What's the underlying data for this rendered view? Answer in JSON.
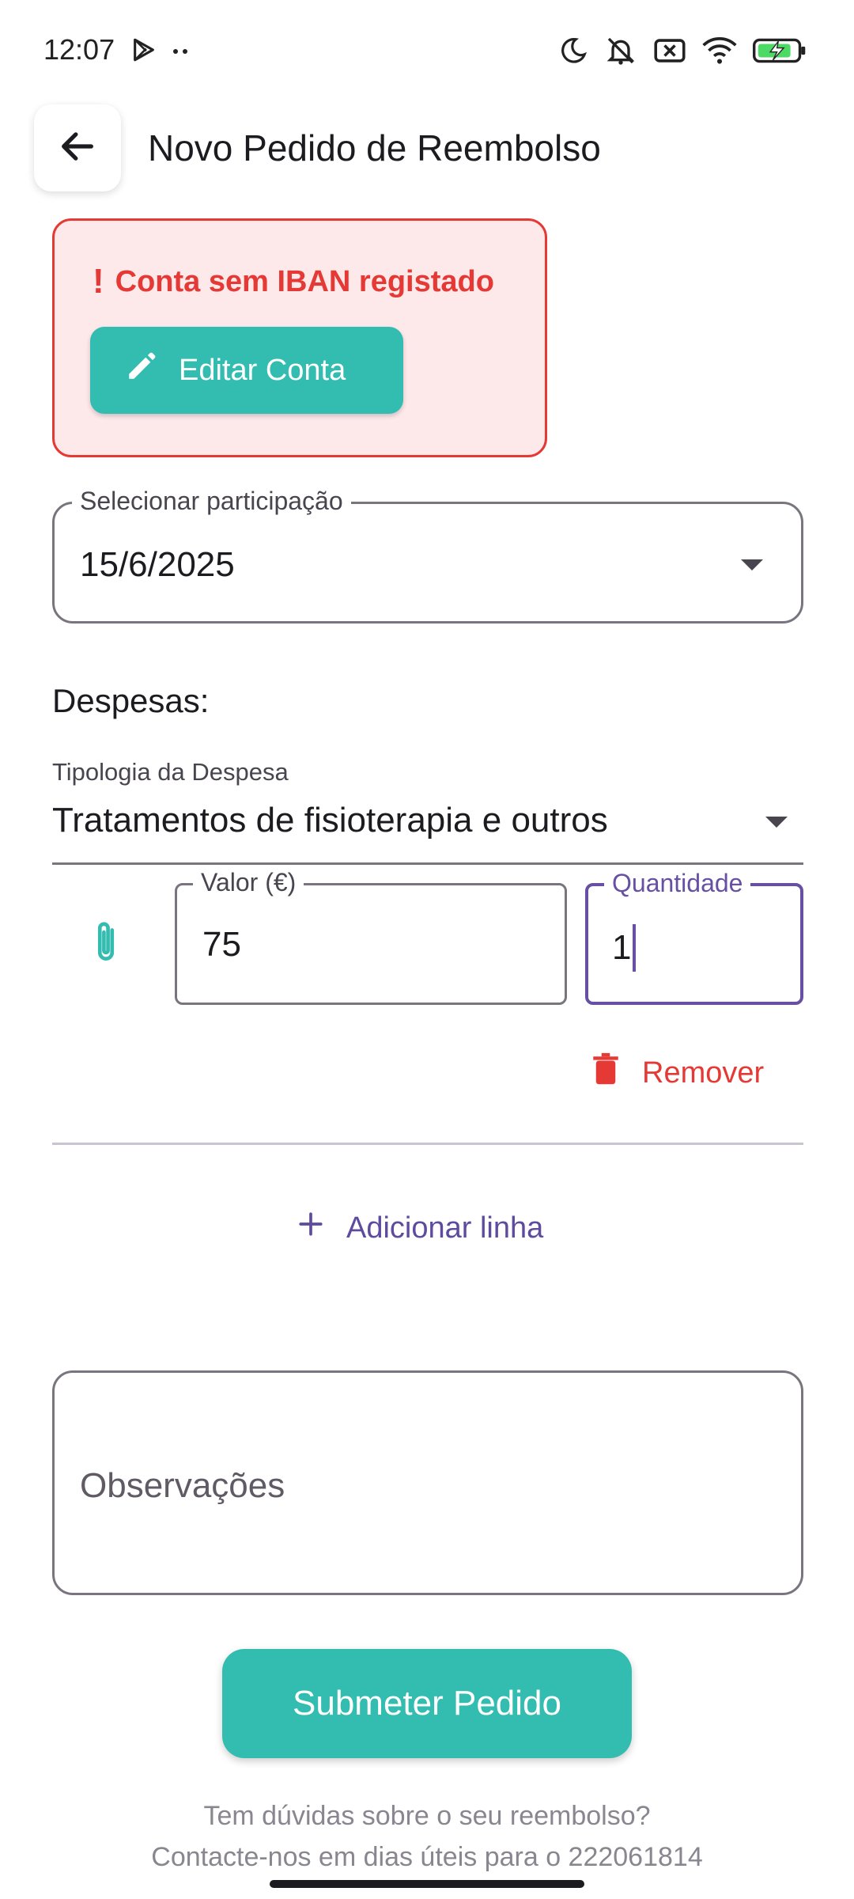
{
  "status_bar": {
    "time": "12:07",
    "left_icons": [
      "play-store-icon",
      "more-dots-icon"
    ],
    "right_icons": [
      "moon-icon",
      "mute-icon",
      "sim-off-icon",
      "wifi-icon",
      "battery-charging-icon"
    ]
  },
  "app_bar": {
    "back_icon": "arrow-back-icon",
    "title": "Novo Pedido de Reembolso"
  },
  "alert": {
    "icon": "!",
    "message": "Conta sem IBAN registado",
    "button_label": "Editar Conta",
    "button_icon": "pencil-icon"
  },
  "participation_select": {
    "label": "Selecionar participação",
    "value": "15/6/2025"
  },
  "expenses": {
    "section_title": "Despesas:",
    "type_label": "Tipologia da Despesa",
    "type_value": "Tratamentos de fisioterapia e outros",
    "attach_icon": "paperclip-icon",
    "value_label": "Valor (€)",
    "value": "75",
    "quantity_label": "Quantidade",
    "quantity": "1",
    "remove_label": "Remover",
    "remove_icon": "trash-icon",
    "add_line_label": "Adicionar linha",
    "add_icon": "plus-icon"
  },
  "notes": {
    "placeholder": "Observações"
  },
  "submit": {
    "label": "Submeter Pedido"
  },
  "help": {
    "line1": "Tem dúvidas sobre o seu reembolso?",
    "line2": "Contacte-nos em dias úteis para o 222061814"
  },
  "colors": {
    "accent_teal": "#33bcb0",
    "error_red": "#e53935",
    "alert_bg": "#fde8ea",
    "focus_purple": "#6750a4"
  }
}
